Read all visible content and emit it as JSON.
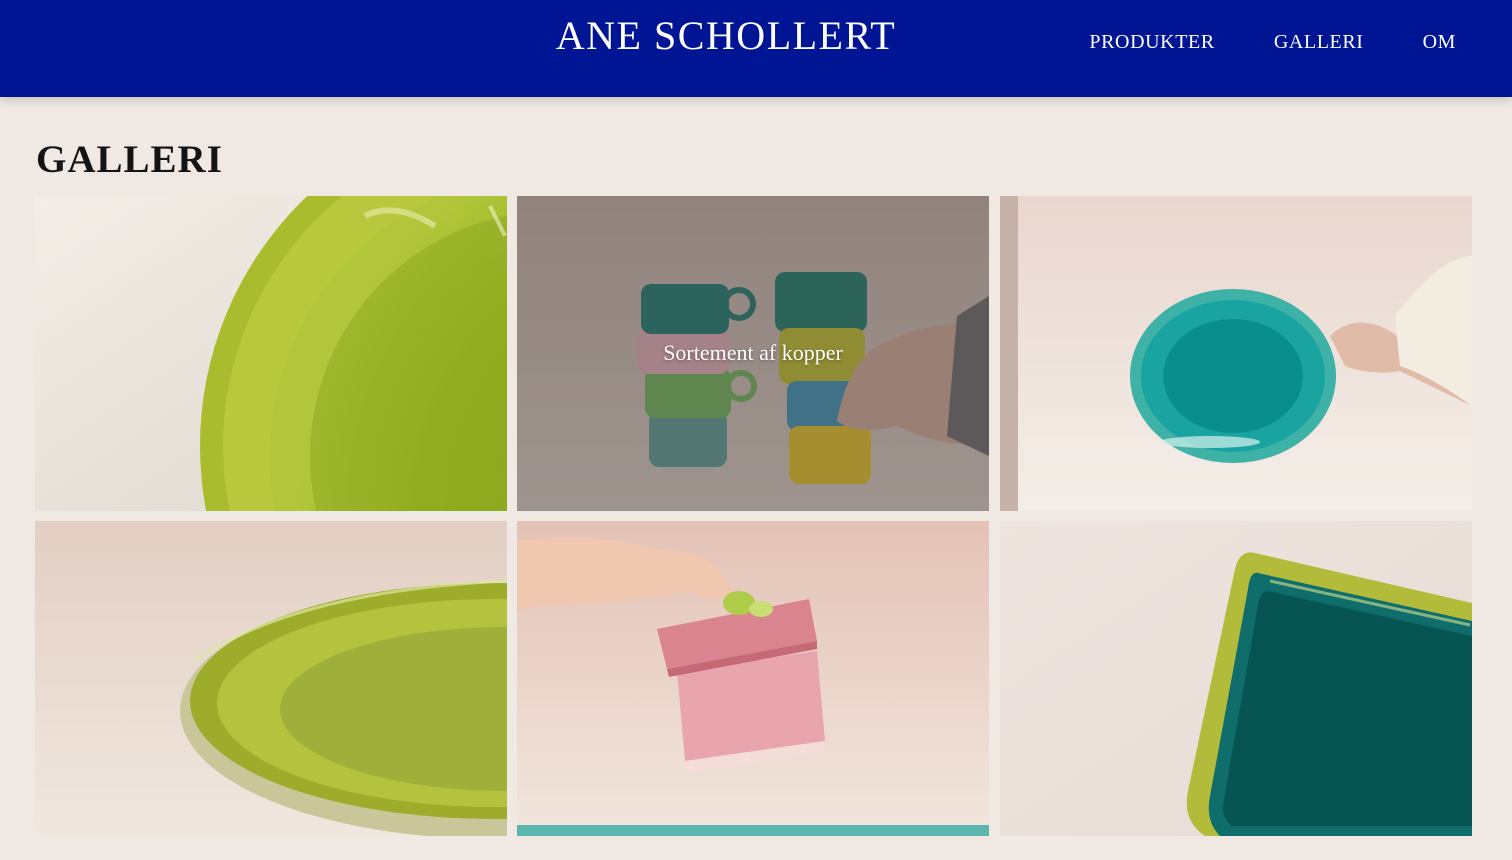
{
  "header": {
    "brand": "ANE SCHOLLERT",
    "nav": [
      "PRODUKTER",
      "GALLERI",
      "OM"
    ]
  },
  "page": {
    "title": "GALLERI"
  },
  "gallery": {
    "items": [
      {
        "subject": "green-plate-closeup"
      },
      {
        "subject": "stacked-cups",
        "caption": "Sortement af kopper"
      },
      {
        "subject": "teal-oval-plate"
      },
      {
        "subject": "green-plate-side"
      },
      {
        "subject": "pink-lidded-box"
      },
      {
        "subject": "teal-rectangular-dish"
      }
    ]
  },
  "colors": {
    "header_bg": "#001594",
    "page_bg": "#f0e9e3",
    "text_dark": "#141414",
    "text_light": "#ffffff"
  }
}
